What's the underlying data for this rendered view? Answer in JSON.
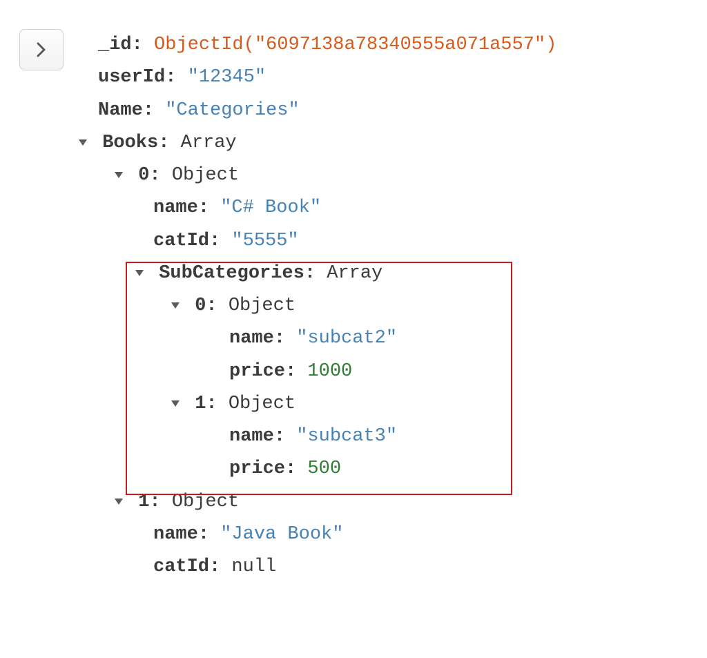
{
  "document": {
    "id_key": "_id",
    "id_value": "ObjectId(\"6097138a78340555a071a557\")",
    "userId_key": "userId",
    "userId_value": "\"12345\"",
    "name_key": "Name",
    "name_value": "\"Categories\"",
    "books_key": "Books",
    "array_label": "Array",
    "object_label": "Object",
    "null_label": "null",
    "books": {
      "0": {
        "index": "0",
        "name_key": "name",
        "name_value": "\"C# Book\"",
        "catId_key": "catId",
        "catId_value": "\"5555\"",
        "sub_key": "SubCategories",
        "sub": {
          "0": {
            "index": "0",
            "name_key": "name",
            "name_value": "\"subcat2\"",
            "price_key": "price",
            "price_value": "1000"
          },
          "1": {
            "index": "1",
            "name_key": "name",
            "name_value": "\"subcat3\"",
            "price_key": "price",
            "price_value": "500"
          }
        }
      },
      "1": {
        "index": "1",
        "name_key": "name",
        "name_value": "\"Java Book\"",
        "catId_key": "catId"
      }
    }
  }
}
